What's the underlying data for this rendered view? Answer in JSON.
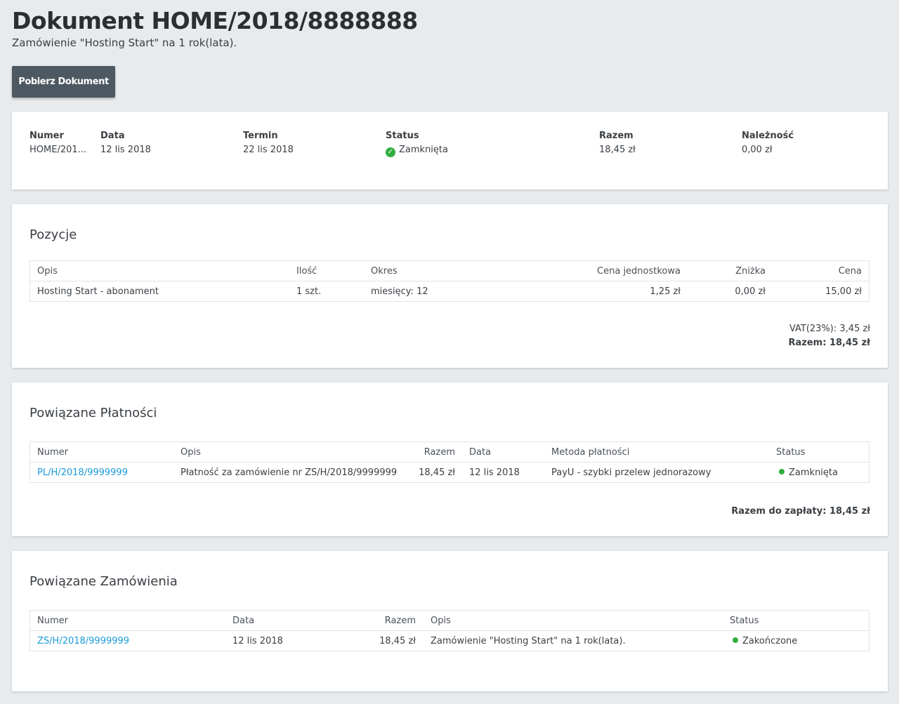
{
  "header": {
    "title": "Dokument HOME/2018/8888888",
    "subtitle": "Zamówienie \"Hosting Start\" na 1 rok(lata).",
    "download_label": "Pobierz Dokument"
  },
  "summary": {
    "numer_label": "Numer",
    "numer_value": "HOME/201...",
    "data_label": "Data",
    "data_value": "12 lis 2018",
    "termin_label": "Termin",
    "termin_value": "22 lis 2018",
    "status_label": "Status",
    "status_value": "Zamknięta",
    "razem_label": "Razem",
    "razem_value": "18,45 zł",
    "naleznosc_label": "Należność",
    "naleznosc_value": "0,00 zł",
    "status_color": "#2fae3e"
  },
  "positions": {
    "title": "Pozycje",
    "headers": {
      "opis": "Opis",
      "ilosc": "Ilość",
      "okres": "Okres",
      "cena_jedn": "Cena jednostkowa",
      "znizka": "Zniżka",
      "cena": "Cena"
    },
    "rows": [
      {
        "opis": "Hosting Start - abonament",
        "ilosc": "1 szt.",
        "okres": "miesięcy: 12",
        "cena_jedn": "1,25 zł",
        "znizka": "0,00 zł",
        "cena": "15,00 zł"
      }
    ],
    "vat": "VAT(23%): 3,45 zł",
    "total": "Razem: 18,45 zł"
  },
  "payments": {
    "title": "Powiązane Płatności",
    "headers": {
      "numer": "Numer",
      "opis": "Opis",
      "razem": "Razem",
      "data": "Data",
      "metoda": "Metoda płatności",
      "status": "Status"
    },
    "rows": [
      {
        "numer": "PL/H/2018/9999999",
        "opis": "Płatność za zamówienie nr ZS/H/2018/9999999",
        "razem": "18,45 zł",
        "data": "12 lis 2018",
        "metoda": "PayU - szybki przelew jednorazowy",
        "status": "Zamknięta"
      }
    ],
    "total": "Razem do zapłaty: 18,45 zł"
  },
  "orders": {
    "title": "Powiązane Zamówienia",
    "headers": {
      "numer": "Numer",
      "data": "Data",
      "razem": "Razem",
      "opis": "Opis",
      "status": "Status"
    },
    "rows": [
      {
        "numer": "ZS/H/2018/9999999",
        "data": "12 lis 2018",
        "razem": "18,45 zł",
        "opis": "Zamówienie \"Hosting Start\" na 1 rok(lata).",
        "status": "Zakończone"
      }
    ]
  },
  "colors": {
    "link": "#1a9ad6",
    "status_ok": "#2fae3e",
    "button": "#4d5862",
    "background": "#e8ebee"
  }
}
